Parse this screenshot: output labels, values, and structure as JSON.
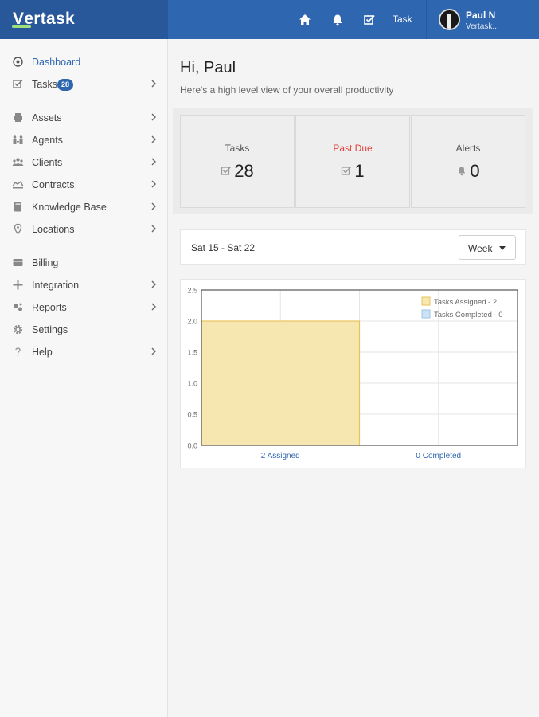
{
  "header": {
    "brand_first": "V",
    "brand_rest": "ertask",
    "nav_icons": [
      "home-icon",
      "bell-icon",
      "checkbox-icon"
    ],
    "task_link": "Task",
    "user_name": "Paul N",
    "user_org": "Vertask..."
  },
  "sidebar": {
    "items": [
      {
        "label": "Dashboard",
        "icon": "dashboard-icon",
        "chevron": false,
        "active": true
      },
      {
        "label": "Tasks",
        "icon": "tasks-icon",
        "chevron": true,
        "badge": "28"
      },
      {
        "label": "Assets",
        "icon": "assets-icon",
        "chevron": true
      },
      {
        "label": "Agents",
        "icon": "agents-icon",
        "chevron": true
      },
      {
        "label": "Clients",
        "icon": "clients-icon",
        "chevron": true
      },
      {
        "label": "Contracts",
        "icon": "contracts-icon",
        "chevron": true
      },
      {
        "label": "Knowledge Base",
        "icon": "book-icon",
        "chevron": true
      },
      {
        "label": "Locations",
        "icon": "location-pin-icon",
        "chevron": true
      },
      {
        "label": "Billing",
        "icon": "billing-icon",
        "chevron": false
      },
      {
        "label": "Integration",
        "icon": "plus-icon",
        "chevron": true
      },
      {
        "label": "Reports",
        "icon": "reports-icon",
        "chevron": true
      },
      {
        "label": "Settings",
        "icon": "gear-icon",
        "chevron": false
      },
      {
        "label": "Help",
        "icon": "question-icon",
        "chevron": true
      }
    ]
  },
  "main": {
    "greeting": "Hi, Paul",
    "subtitle": "Here's a high level view of your overall productivity",
    "stats": [
      {
        "label": "Tasks",
        "value": "28",
        "icon": "checkbox-icon"
      },
      {
        "label": "Past Due",
        "value": "1",
        "icon": "checkbox-icon",
        "color": "#e0443e"
      },
      {
        "label": "Alerts",
        "value": "0",
        "icon": "bell-icon"
      }
    ],
    "week_range": "Sat 15 - Sat 22",
    "week_select": "Week"
  },
  "colors": {
    "header": "#2f66b0",
    "brand_bg": "#28579a",
    "accent": "#2f66b0",
    "past_due": "#e0443e",
    "assigned_fill": "#f6e6b0",
    "assigned_border": "#e8c35a",
    "completed_fill": "#cde3f5"
  },
  "chart_data": {
    "type": "bar",
    "categories": [
      "2 Assigned",
      "0 Completed"
    ],
    "series": [
      {
        "name": "Tasks Assigned - 2",
        "values": [
          2,
          0
        ]
      },
      {
        "name": "Tasks Completed - 0",
        "values": [
          0,
          0
        ]
      }
    ],
    "ylim": [
      0,
      2.5
    ],
    "yticks": [
      "0.0",
      "0.5",
      "1.0",
      "1.5",
      "2.0",
      "2.5"
    ],
    "grid": true,
    "legend": "top-right"
  }
}
